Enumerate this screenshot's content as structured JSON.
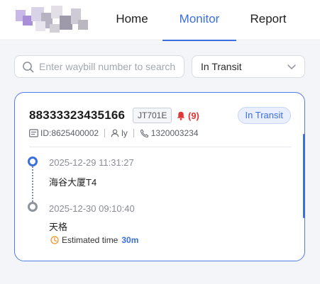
{
  "nav": {
    "tabs": [
      "Home",
      "Monitor",
      "Report"
    ],
    "active_tab": "Monitor"
  },
  "search": {
    "placeholder": "Enter waybill number to search",
    "value": ""
  },
  "filter": {
    "selected": "In Transit"
  },
  "card": {
    "waybill_number": "88333323435166",
    "flight_tag": "JT701E",
    "alert_count": "(9)",
    "status": "In Transit",
    "id_text": "ID:8625400002",
    "user": "ly",
    "phone": "1320003234",
    "timeline": [
      {
        "time": "2025-12-29 11:31:27",
        "place": "海谷大厦T4"
      },
      {
        "time": "2025-12-30 09:10:40",
        "place": "天格"
      }
    ],
    "eta_label": "Estimated time",
    "eta_value": "30m"
  },
  "colors": {
    "accent": "#3b6fe0",
    "alert": "#e03535",
    "eta_icon": "#f0962f"
  },
  "icons": [
    "search-icon",
    "chevron-down-icon",
    "bell-icon",
    "id-card-icon",
    "user-icon",
    "phone-icon",
    "clock-icon"
  ]
}
